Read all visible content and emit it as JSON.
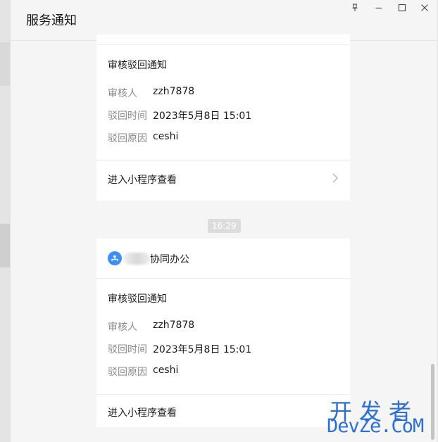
{
  "window": {
    "title": "服务通知"
  },
  "messages": [
    {
      "notice_title": "审核驳回通知",
      "rows": [
        {
          "label": "审核人",
          "value": "zzh7878"
        },
        {
          "label": "驳回时间",
          "value": "2023年5月8日 15:01"
        },
        {
          "label": "驳回原因",
          "value": "ceshi"
        }
      ],
      "link": "进入小程序查看"
    },
    {
      "time": "16:29",
      "source_name": "协同办公",
      "notice_title": "审核驳回通知",
      "rows": [
        {
          "label": "审核人",
          "value": "zzh7878"
        },
        {
          "label": "驳回时间",
          "value": "2023年5月8日 15:01"
        },
        {
          "label": "驳回原因",
          "value": "ceshi"
        }
      ],
      "link": "进入小程序查看"
    }
  ],
  "watermark": {
    "top": "开发者",
    "bottom": "DevZe.CoM"
  },
  "colors": {
    "accent_icon": "#3d8ff5",
    "watermark": "#2e6fd4"
  }
}
